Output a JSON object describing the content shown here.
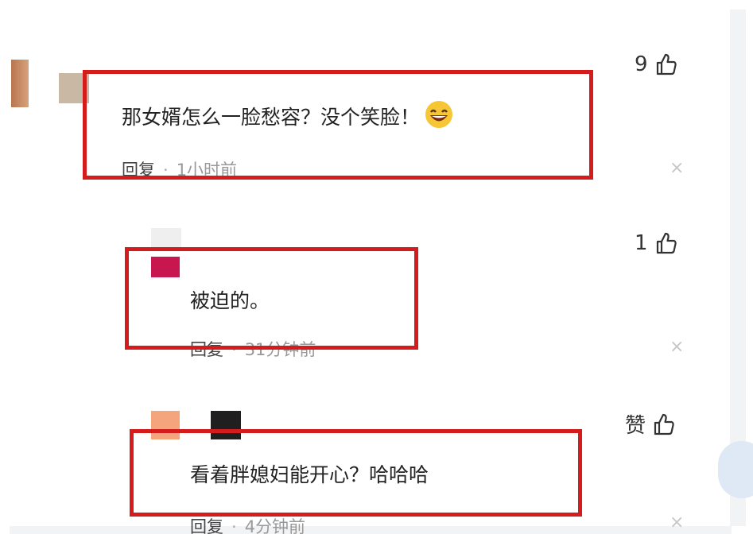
{
  "comments": [
    {
      "text": "那女婿怎么一脸愁容？没个笑脸！",
      "reply_label": "回复",
      "time": "1小时前",
      "likes": "9",
      "emoji": "grinning-face-emoji"
    },
    {
      "text": "被迫的。",
      "reply_label": "回复",
      "time": "31分钟前",
      "likes": "1"
    },
    {
      "text": "看着胖媳妇能开心？哈哈哈",
      "reply_label": "回复",
      "time": "4分钟前",
      "likes": "赞"
    }
  ],
  "close_symbol": "×",
  "colors": {
    "highlight_box": "#d41c1c",
    "text": "#222222",
    "meta": "#999999"
  }
}
